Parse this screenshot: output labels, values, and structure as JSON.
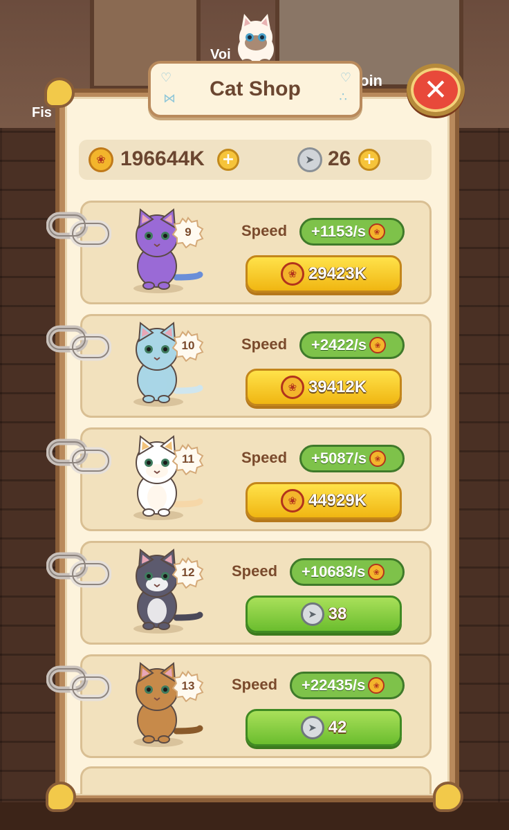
{
  "title": "Cat Shop",
  "currency": {
    "paw_coins": "196644K",
    "fish_coins": "26"
  },
  "background_labels": {
    "left": "Fis",
    "voice": "Voi",
    "join": "oin"
  },
  "speed_label": "Speed",
  "cats": [
    {
      "level": "9",
      "speed": "+1153/s",
      "price": "29423K",
      "price_type": "paw",
      "color": "#9a6ad6"
    },
    {
      "level": "10",
      "speed": "+2422/s",
      "price": "39412K",
      "price_type": "paw",
      "color": "#a9d6e6"
    },
    {
      "level": "11",
      "speed": "+5087/s",
      "price": "44929K",
      "price_type": "paw",
      "color": "#ffffff"
    },
    {
      "level": "12",
      "speed": "+10683/s",
      "price": "38",
      "price_type": "fish",
      "color": "#5c5a6e"
    },
    {
      "level": "13",
      "speed": "+22435/s",
      "price": "42",
      "price_type": "fish",
      "color": "#c78a4a"
    }
  ]
}
